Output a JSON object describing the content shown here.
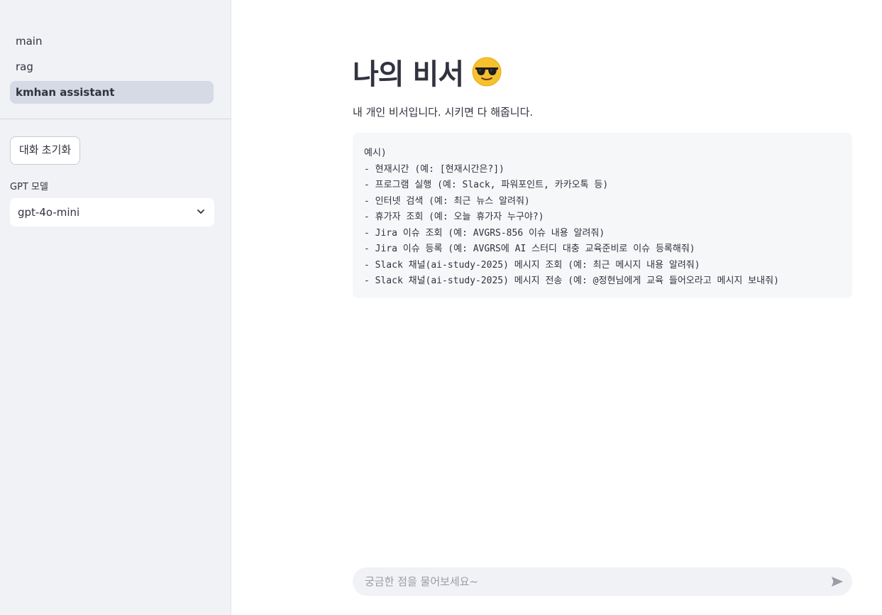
{
  "sidebar": {
    "nav": [
      {
        "label": "main"
      },
      {
        "label": "rag"
      },
      {
        "label": "kmhan assistant"
      }
    ],
    "reset_button_label": "대화 초기화",
    "model_select": {
      "label": "GPT 모델",
      "value": "gpt-4o-mini"
    }
  },
  "main": {
    "title": "나의 비서",
    "title_emoji": "smiling-face-with-sunglasses",
    "subtitle": "내 개인 비서입니다. 시키면 다 해줍니다.",
    "examples": [
      "예시)",
      "- 현재시간 (예: [현재시간은?])",
      "- 프로그램 실행 (예: Slack, 파워포인트, 카카오톡 등)",
      "- 인터넷 검색 (예: 최근 뉴스 알려줘)",
      "- 휴가자 조회 (예: 오늘 휴가자 누구야?)",
      "- Jira 이슈 조회 (예: AVGRS-856 이슈 내용 알려줘)",
      "- Jira 이슈 등록 (예: AVGRS에 AI 스터디 대충 교육준비로 이슈 등록해줘)",
      "- Slack 채널(ai-study-2025) 메시지 조회 (예: 최근 메시지 내용 알려줘)",
      "- Slack 채널(ai-study-2025) 메시지 전송 (예: @정현님에게 교육 들어오라고 메시지 보내줘)"
    ],
    "chat_input": {
      "placeholder": "궁금한 점을 물어보세요~",
      "value": ""
    }
  },
  "colors": {
    "sidebar_bg": "#f0f2f6",
    "active_nav_bg": "#d5dae5",
    "text": "#31333f"
  }
}
